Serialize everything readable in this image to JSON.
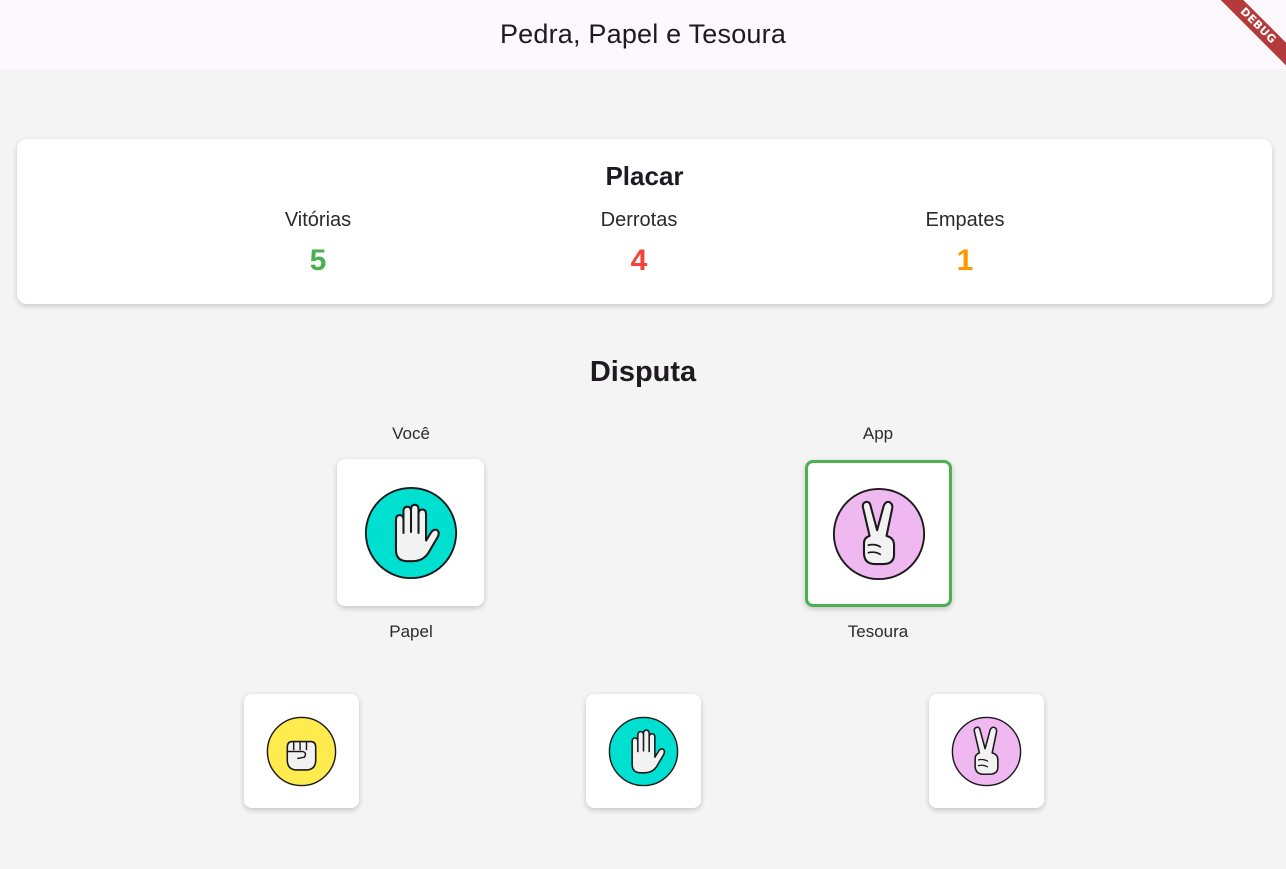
{
  "app": {
    "title": "Pedra, Papel e Tesoura",
    "debug_banner": "DEBUG"
  },
  "scoreboard": {
    "title": "Placar",
    "wins": {
      "label": "Vitórias",
      "value": "5",
      "color": "#4caf50"
    },
    "losses": {
      "label": "Derrotas",
      "value": "4",
      "color": "#f44336"
    },
    "draws": {
      "label": "Empates",
      "value": "1",
      "color": "#ff9800"
    }
  },
  "battle": {
    "title": "Disputa",
    "player": {
      "label": "Você",
      "choice": "Papel",
      "icon": "paper-hand-icon"
    },
    "app": {
      "label": "App",
      "choice": "Tesoura",
      "icon": "scissors-hand-icon",
      "highlight_color": "#4caf50"
    }
  },
  "options": [
    {
      "name": "rock",
      "icon": "rock-fist-icon",
      "color": "#ffeb4d"
    },
    {
      "name": "paper",
      "icon": "paper-hand-icon",
      "color": "#00e0d0"
    },
    {
      "name": "scissors",
      "icon": "scissors-hand-icon",
      "color": "#f0b8f0"
    }
  ]
}
